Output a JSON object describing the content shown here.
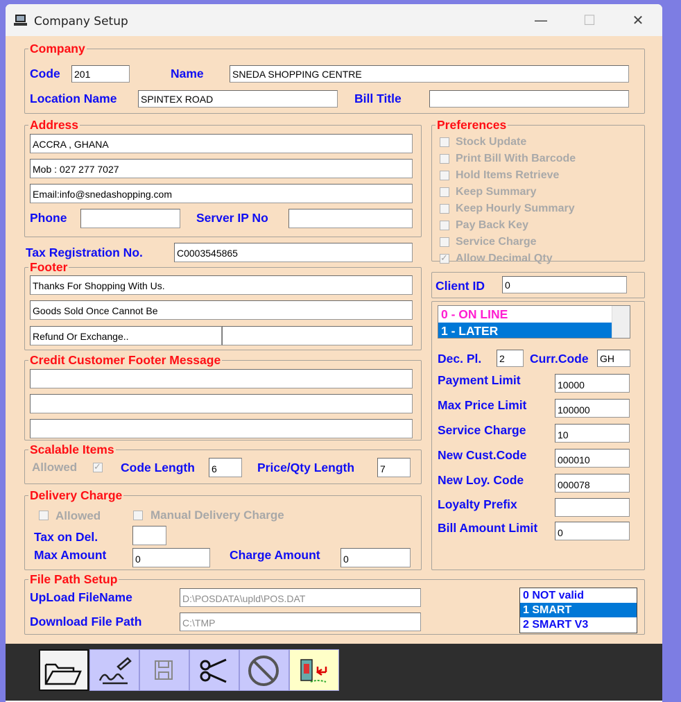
{
  "window": {
    "title": "Company Setup",
    "minimize": "—",
    "maximize": "☐",
    "close": "✕"
  },
  "company": {
    "legend": "Company",
    "code_label": "Code",
    "code_value": "201",
    "name_label": "Name",
    "name_value": "SNEDA SHOPPING CENTRE",
    "location_label": "Location Name",
    "location_value": "SPINTEX ROAD",
    "bill_title_label": "Bill Title",
    "bill_title_value": ""
  },
  "address": {
    "legend": "Address",
    "line1": "ACCRA , GHANA",
    "line2": "Mob : 027 277 7027",
    "line3": "Email:info@snedashopping.com",
    "phone_label": "Phone",
    "phone_value": "",
    "server_ip_label": "Server IP No",
    "server_ip_value": ""
  },
  "tax": {
    "label": "Tax Registration No.",
    "value": "C0003545865"
  },
  "footer": {
    "legend": "Footer",
    "line1": "Thanks For Shopping With Us.",
    "line2": "Goods Sold Once Cannot Be",
    "line3": "Refund Or Exchange..",
    "line4": ""
  },
  "credit_footer": {
    "legend": "Credit Customer Footer Message",
    "line1": "",
    "line2": "",
    "line3": ""
  },
  "scalable": {
    "legend": "Scalable Items",
    "allowed_label": "Allowed",
    "allowed_checked": true,
    "code_length_label": "Code Length",
    "code_length_value": "6",
    "price_qty_label": "Price/Qty Length",
    "price_qty_value": "7"
  },
  "delivery": {
    "legend": "Delivery Charge",
    "allowed_label": "Allowed",
    "manual_label": "Manual Delivery Charge",
    "tax_label": "Tax on Del.",
    "tax_value": "",
    "max_amount_label": "Max Amount",
    "max_amount_value": "0",
    "charge_amount_label": "Charge Amount",
    "charge_amount_value": "0"
  },
  "preferences": {
    "legend": "Preferences",
    "items": [
      {
        "label": "Stock Update",
        "checked": false
      },
      {
        "label": "Print Bill With Barcode",
        "checked": false
      },
      {
        "label": "Hold Items Retrieve",
        "checked": false
      },
      {
        "label": "Keep Summary",
        "checked": false
      },
      {
        "label": "Keep Hourly Summary",
        "checked": false
      },
      {
        "label": "Pay Back Key",
        "checked": false
      },
      {
        "label": "Service Charge",
        "checked": false
      },
      {
        "label": "Allow Decimal Qty",
        "checked": true
      }
    ]
  },
  "client": {
    "label": "Client ID",
    "value": "0"
  },
  "mode_list": {
    "items": [
      "0 - ON LINE",
      "1 - LATER"
    ],
    "selected_index": 1,
    "item0_color": "#ff1fd1",
    "selected_bg": "#0078d7"
  },
  "settings": {
    "dec_pl_label": "Dec. Pl.",
    "dec_pl_value": "2",
    "curr_code_label": "Curr.Code",
    "curr_code_value": "GH",
    "payment_limit_label": "Payment Limit",
    "payment_limit_value": "10000",
    "max_price_label": "Max Price Limit",
    "max_price_value": "100000",
    "service_charge_label": "Service Charge",
    "service_charge_value": "10",
    "new_cust_label": "New Cust.Code",
    "new_cust_value": "000010",
    "new_loy_label": "New Loy. Code",
    "new_loy_value": "000078",
    "loyalty_prefix_label": "Loyalty Prefix",
    "loyalty_prefix_value": "",
    "bill_limit_label": "Bill Amount Limit",
    "bill_limit_value": "0"
  },
  "file_path": {
    "legend": "File Path Setup",
    "upload_label": "UpLoad FileName",
    "upload_value": "D:\\POSDATA\\upld\\POS.DAT",
    "download_label": "Download File Path",
    "download_value": "C:\\TMP"
  },
  "format_list": {
    "items": [
      "0 NOT valid",
      "1 SMART",
      "2 SMART V3"
    ],
    "selected_index": 1
  },
  "toolbar": {
    "buttons": [
      "open-icon",
      "sign-icon",
      "save-icon",
      "cut-icon",
      "cancel-icon",
      "exit-icon"
    ]
  },
  "colors": {
    "label": "#0f0ef3",
    "legend": "#ff0e14",
    "background": "#f9dfc3",
    "toolbar": "#2e2e2e"
  }
}
